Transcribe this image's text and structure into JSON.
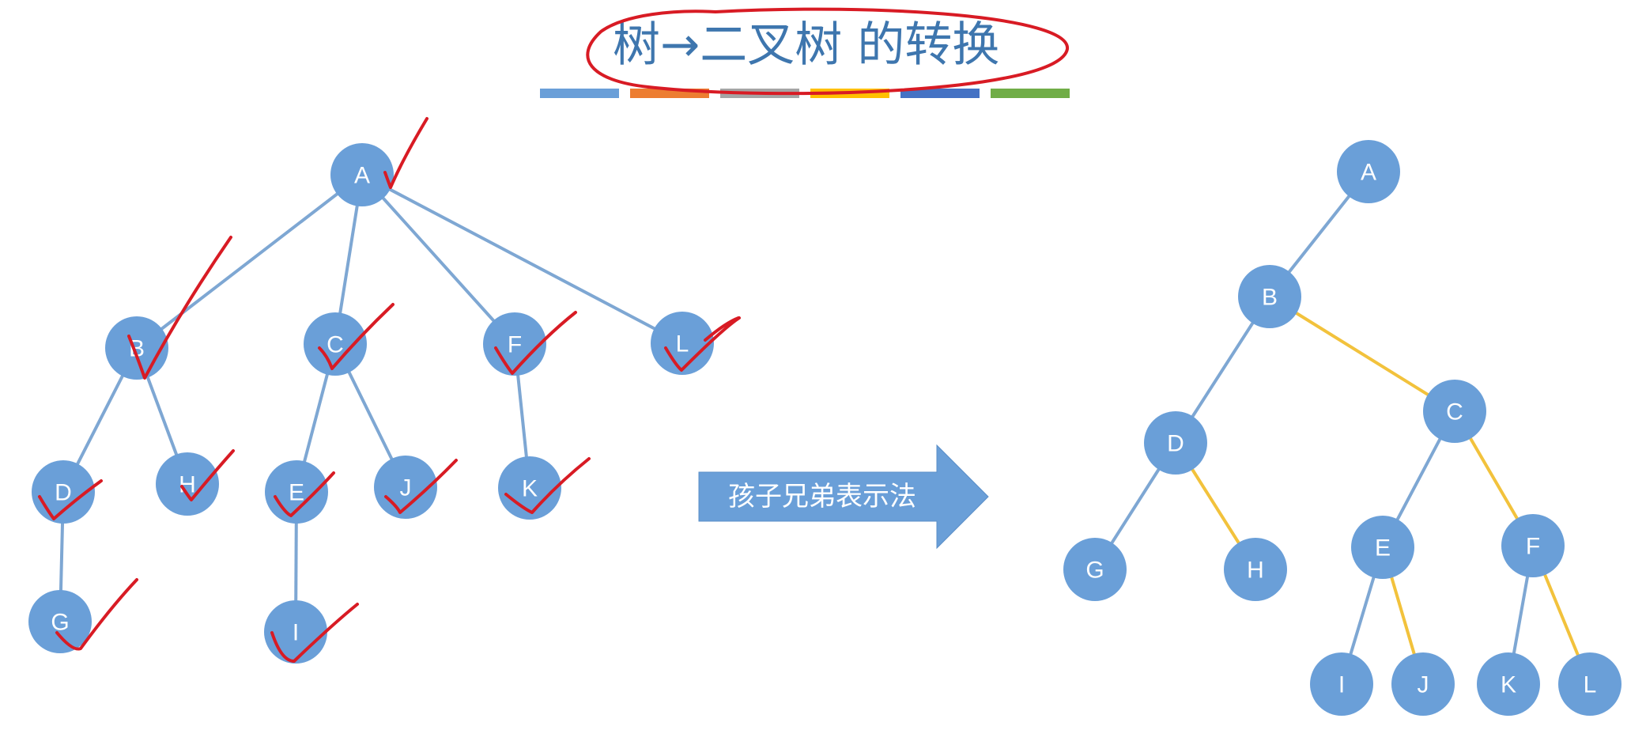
{
  "title": "树→二叉树 的转换",
  "palette": [
    "#6a9fd8",
    "#ed7d31",
    "#a5a5a5",
    "#ffc000",
    "#4472c4",
    "#70ad47"
  ],
  "arrow_label": "孩子兄弟表示法",
  "tree": {
    "nodes": [
      "A",
      "B",
      "C",
      "F",
      "L",
      "D",
      "H",
      "E",
      "J",
      "K",
      "G",
      "I"
    ],
    "edges": [
      [
        "A",
        "B"
      ],
      [
        "A",
        "C"
      ],
      [
        "A",
        "F"
      ],
      [
        "A",
        "L"
      ],
      [
        "B",
        "D"
      ],
      [
        "B",
        "H"
      ],
      [
        "C",
        "E"
      ],
      [
        "C",
        "J"
      ],
      [
        "F",
        "K"
      ],
      [
        "D",
        "G"
      ],
      [
        "E",
        "I"
      ]
    ]
  },
  "binary_tree": {
    "nodes": [
      "A",
      "B",
      "C",
      "D",
      "G",
      "H",
      "E",
      "F",
      "I",
      "J",
      "K",
      "L"
    ],
    "child_edges": [
      [
        "A",
        "B"
      ],
      [
        "B",
        "D"
      ],
      [
        "D",
        "G"
      ],
      [
        "C",
        "E"
      ],
      [
        "E",
        "I"
      ],
      [
        "F",
        "K"
      ]
    ],
    "sibling_edges": [
      [
        "B",
        "C"
      ],
      [
        "D",
        "H"
      ],
      [
        "C",
        "F"
      ],
      [
        "E",
        "J"
      ],
      [
        "F",
        "L"
      ]
    ]
  }
}
